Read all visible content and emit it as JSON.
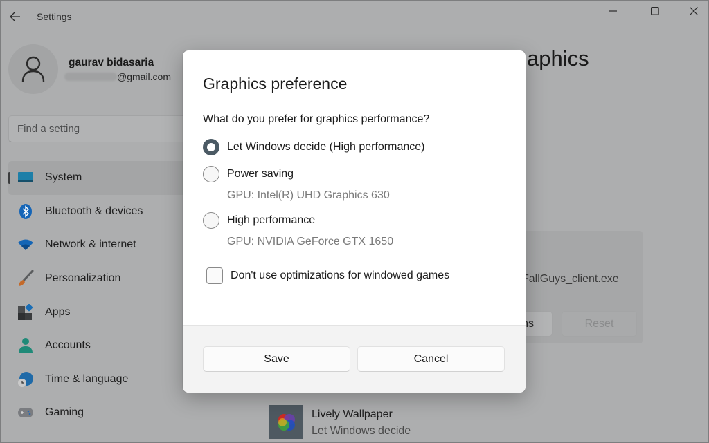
{
  "window": {
    "title": "Settings",
    "controls": {
      "minimize": "minimize",
      "maximize": "maximize",
      "close": "close"
    }
  },
  "user": {
    "name": "gaurav bidasaria",
    "email_visible": "@gmail.com"
  },
  "search": {
    "placeholder": "Find a setting",
    "value": ""
  },
  "sidebar": {
    "items": [
      {
        "label": "System",
        "icon": "system-icon",
        "active": true
      },
      {
        "label": "Bluetooth & devices",
        "icon": "bluetooth-icon"
      },
      {
        "label": "Network & internet",
        "icon": "wifi-icon"
      },
      {
        "label": "Personalization",
        "icon": "brush-icon"
      },
      {
        "label": "Apps",
        "icon": "apps-icon"
      },
      {
        "label": "Accounts",
        "icon": "account-icon"
      },
      {
        "label": "Time & language",
        "icon": "globe-clock-icon"
      },
      {
        "label": "Gaming",
        "icon": "gamepad-icon"
      }
    ]
  },
  "page": {
    "title_partial": "aphics",
    "app_card": {
      "exe": "FallGuys_client.exe",
      "options_partial": "ns",
      "reset": "Reset"
    },
    "apps": [
      {
        "name": "Lively Wallpaper",
        "preference": "Let Windows decide"
      }
    ]
  },
  "dialog": {
    "title": "Graphics preference",
    "question": "What do you prefer for graphics performance?",
    "options": [
      {
        "label": "Let Windows decide (High performance)",
        "checked": true,
        "gpu": ""
      },
      {
        "label": "Power saving",
        "checked": false,
        "gpu": "GPU: Intel(R) UHD Graphics 630"
      },
      {
        "label": "High performance",
        "checked": false,
        "gpu": "GPU: NVIDIA GeForce GTX 1650"
      }
    ],
    "checkbox": {
      "label": "Don't use optimizations for windowed games",
      "checked": false
    },
    "save": "Save",
    "cancel": "Cancel"
  },
  "colors": {
    "accent": "#4b5a64",
    "backdrop": "#adaeaf",
    "dialog_bg": "#ffffff",
    "footer_bg": "#f3f3f3"
  }
}
